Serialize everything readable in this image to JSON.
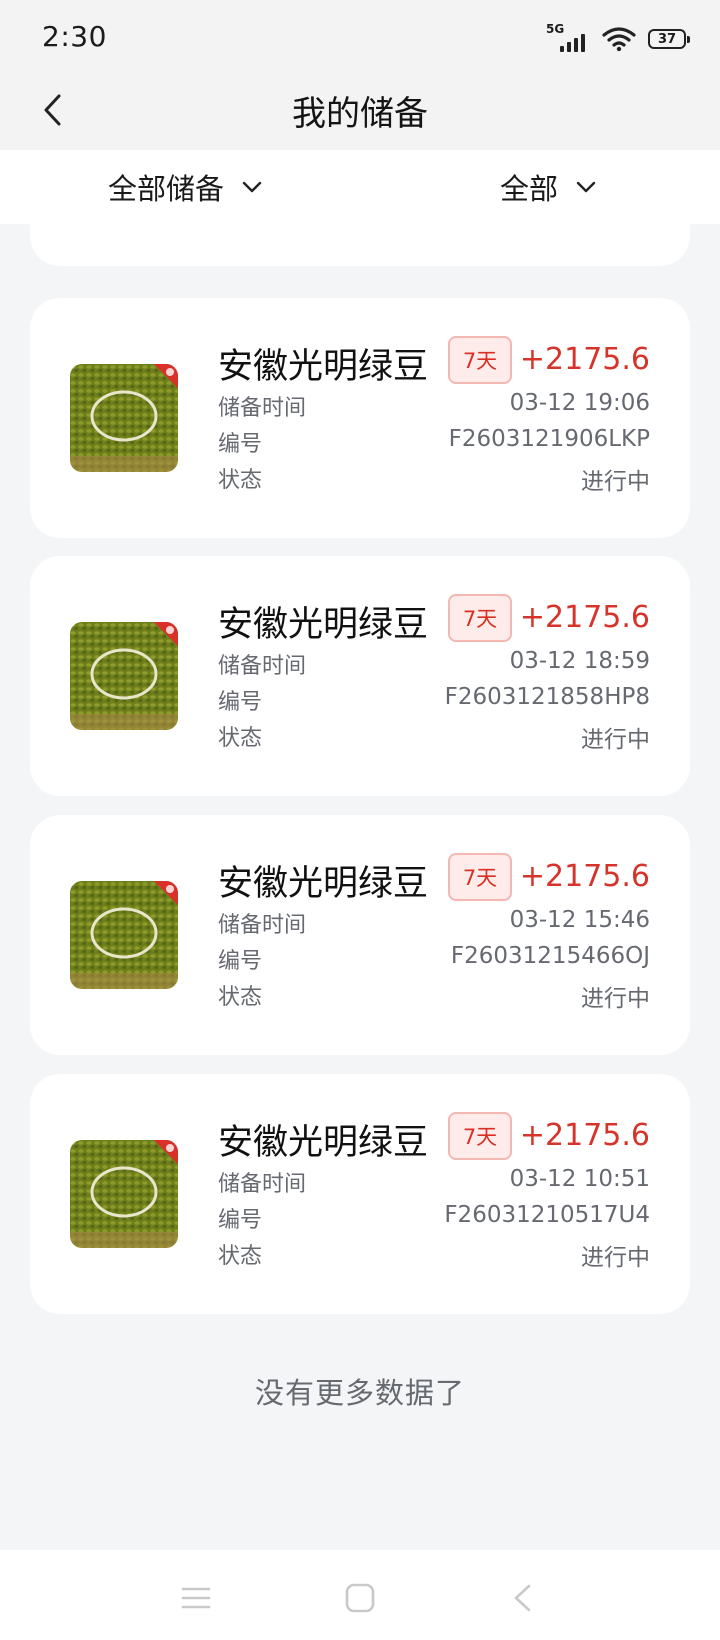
{
  "status_bar": {
    "time": "2:30",
    "network": "5G",
    "battery": "37"
  },
  "nav": {
    "title": "我的储备"
  },
  "filters": {
    "left_label": "全部储备",
    "right_label": "全部"
  },
  "records": [
    {
      "name": "安徽光明绿豆",
      "tag": "7天",
      "amount": "+2175.6",
      "time_label": "储备时间",
      "time": "03-12 19:06",
      "id_label": "编号",
      "id": "F2603121906LKP",
      "status_label": "状态",
      "status": "进行中"
    },
    {
      "name": "安徽光明绿豆",
      "tag": "7天",
      "amount": "+2175.6",
      "time_label": "储备时间",
      "time": "03-12 18:59",
      "id_label": "编号",
      "id": "F2603121858HP8",
      "status_label": "状态",
      "status": "进行中"
    },
    {
      "name": "安徽光明绿豆",
      "tag": "7天",
      "amount": "+2175.6",
      "time_label": "储备时间",
      "time": "03-12 15:46",
      "id_label": "编号",
      "id": "F26031215466OJ",
      "status_label": "状态",
      "status": "进行中"
    },
    {
      "name": "安徽光明绿豆",
      "tag": "7天",
      "amount": "+2175.6",
      "time_label": "储备时间",
      "time": "03-12 10:51",
      "id_label": "编号",
      "id": "F26031210517U4",
      "status_label": "状态",
      "status": "进行中"
    }
  ],
  "footer": {
    "no_more_text": "没有更多数据了"
  },
  "colors": {
    "accent_red": "#d6332a",
    "tag_bg": "#fdecea",
    "tag_border": "#f4b7b2",
    "page_bg": "#f4f5f7"
  }
}
